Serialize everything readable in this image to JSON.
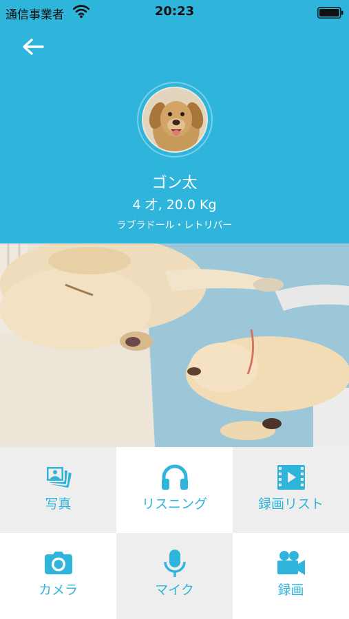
{
  "status_bar": {
    "carrier": "通信事業者",
    "time": "20:23"
  },
  "pet": {
    "name": "ゴン太",
    "info": "4 才, 20.0 Kg",
    "breed": "ラブラドール・レトリバー"
  },
  "menu": [
    {
      "label": "写真",
      "icon": "photos-icon"
    },
    {
      "label": "リスニング",
      "icon": "headphones-icon"
    },
    {
      "label": "録画リスト",
      "icon": "film-icon"
    },
    {
      "label": "カメラ",
      "icon": "camera-icon"
    },
    {
      "label": "マイク",
      "icon": "microphone-icon"
    },
    {
      "label": "録画",
      "icon": "video-camera-icon"
    }
  ],
  "colors": {
    "accent": "#2fb5dc",
    "cell_gray": "#eeeeee",
    "cell_white": "#ffffff"
  }
}
